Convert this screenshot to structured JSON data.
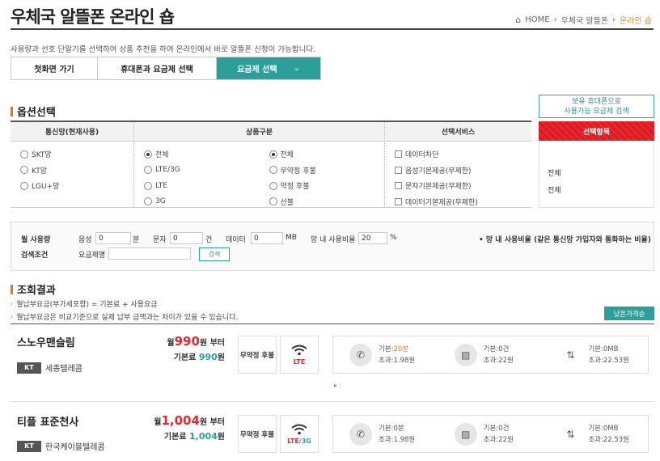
{
  "header": {
    "title": "우체국 알뜰폰 온라인 숍",
    "breadcrumb": [
      "HOME",
      "우체국 알뜰폰",
      "온라인 숍"
    ],
    "description": "사용량과 선호 단말기를 선택하여 상품 추천을 하여 온라인에서 바로 알뜰폰 신청이 가능합니다."
  },
  "steps": [
    {
      "label": "첫화면 가기"
    },
    {
      "label": "휴대폰과 요금제 선택"
    },
    {
      "label": "요금제 선택",
      "active": true
    }
  ],
  "options": {
    "section_title": "옵션선택",
    "columns": [
      {
        "header": "통신망(현재사용)",
        "items": [
          {
            "label": "SKT망",
            "type": "radio",
            "checked": false
          },
          {
            "label": "KT망",
            "type": "radio",
            "checked": false
          },
          {
            "label": "LGU+망",
            "type": "radio",
            "checked": false
          }
        ]
      },
      {
        "header": "상품구분",
        "items_left": [
          {
            "label": "전체",
            "type": "radio",
            "checked": true
          },
          {
            "label": "LTE/3G",
            "type": "radio",
            "checked": false
          },
          {
            "label": "LTE",
            "type": "radio",
            "checked": false
          },
          {
            "label": "3G",
            "type": "radio",
            "checked": false
          }
        ],
        "items_right": [
          {
            "label": "전체",
            "type": "radio",
            "checked": true
          },
          {
            "label": "무약정 후불",
            "type": "radio",
            "checked": false
          },
          {
            "label": "약정 후불",
            "type": "radio",
            "checked": false
          },
          {
            "label": "선불",
            "type": "radio",
            "checked": false
          }
        ]
      },
      {
        "header": "선택서비스",
        "items": [
          {
            "label": "데이터차단",
            "type": "checkbox",
            "checked": false
          },
          {
            "label": "음성기본제공(무제한)",
            "type": "checkbox",
            "checked": false
          },
          {
            "label": "문자기본제공(무제한)",
            "type": "checkbox",
            "checked": false
          },
          {
            "label": "데이터기본제공(무제한)",
            "type": "checkbox",
            "checked": false
          }
        ]
      }
    ],
    "side_button": [
      "보유 휴대폰으로",
      "사용가능 요금제 검색"
    ],
    "selected_header": "선택항목",
    "selected_items": [
      "전체",
      "전체"
    ]
  },
  "search": {
    "monthly_label": "월 사용량",
    "voice_label": "음성",
    "voice_value": "0",
    "voice_unit": "분",
    "sms_label": "문자",
    "sms_value": "0",
    "sms_unit": "건",
    "data_label": "데이터",
    "data_value": "0",
    "data_unit": "MB",
    "ratio_label": "망 내 사용비율",
    "ratio_value": "20",
    "ratio_unit": "%",
    "ratio_note": "• 망 내 사용비율 (같은 통신망 가입자와 통화하는 비율)",
    "condition_label": "검색조건",
    "plan_name_label": "요금제명",
    "plan_name_value": "",
    "search_button": "검색"
  },
  "results": {
    "section_title": "조회결과",
    "notes": [
      "월납부요금(부가세포함) = 기본료 + 사용요금",
      "월납부요금은 비교기준으로 실제 납부 금액과는 차이가 있을 수 있습니다."
    ],
    "sort_button": "낮은가격순",
    "separator_text": "▸ :",
    "items": [
      {
        "name": "스노우맨슬림",
        "carrier_badge": "KT",
        "carrier": "세종텔레콤",
        "monthly_prefix": "월",
        "monthly_price": "990",
        "monthly_suffix": "원 부터",
        "base_label": "기본료",
        "base_price": "990",
        "base_suffix": "원",
        "plan_type": "무약정 후불",
        "network": "LTE",
        "network_extra": "",
        "voice_base": "기본:",
        "voice_base_val": "20분",
        "voice_over": "초과:1.98원",
        "sms_base": "기본:0건",
        "sms_over": "초과:22원",
        "data_base": "기본:0MB",
        "data_over": "초과:22.53원"
      },
      {
        "name": "티플 표준천사",
        "carrier_badge": "KT",
        "carrier": "한국케이블텔레콤",
        "monthly_prefix": "월",
        "monthly_price": "1,004",
        "monthly_suffix": "원 부터",
        "base_label": "기본료",
        "base_price": "1,004",
        "base_suffix": "원",
        "plan_type": "무약정 후불",
        "network": "LTE",
        "network_extra": "/3G",
        "voice_base": "기본:",
        "voice_base_val": "0분",
        "voice_over": "초과:1.98원",
        "sms_base": "기본:0건",
        "sms_over": "초과:22원",
        "data_base": "기본:0MB",
        "data_over": "초과:22.53원"
      }
    ]
  }
}
